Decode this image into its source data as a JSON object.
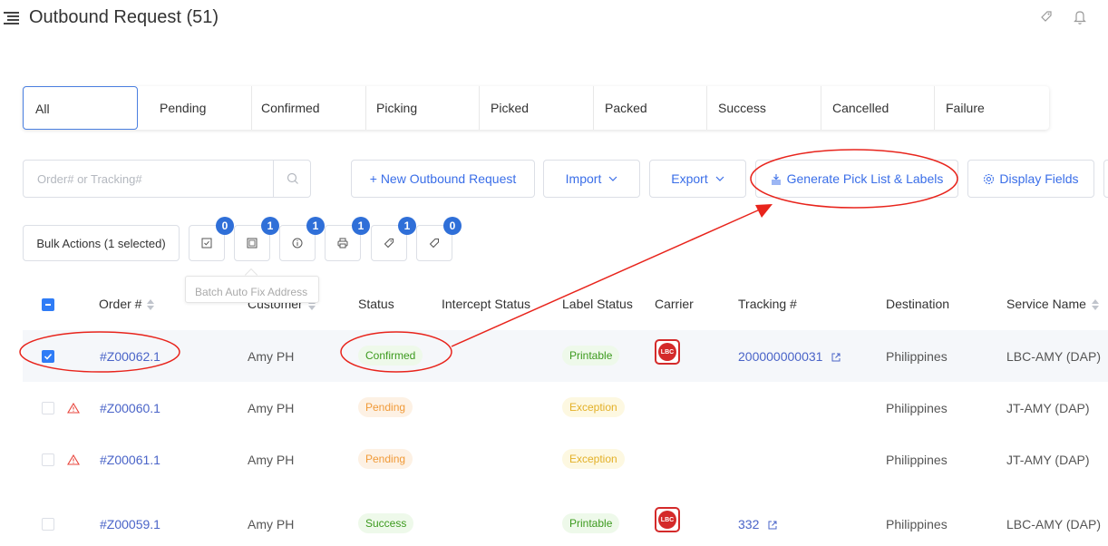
{
  "header": {
    "title": "Outbound Request (51)",
    "icons": [
      "menu-icon",
      "tag-icon",
      "bell-icon"
    ]
  },
  "tabs": [
    {
      "label": "All",
      "active": true
    },
    {
      "label": "Pending"
    },
    {
      "label": "Confirmed"
    },
    {
      "label": "Picking"
    },
    {
      "label": "Picked"
    },
    {
      "label": "Packed"
    },
    {
      "label": "Success"
    },
    {
      "label": "Cancelled"
    },
    {
      "label": "Failure"
    }
  ],
  "toolbar": {
    "search_placeholder": "Order# or Tracking#",
    "new_request": "+ New Outbound Request",
    "import": "Import",
    "export": "Export",
    "generate": "Generate Pick List & Labels",
    "display_fields": "Display Fields"
  },
  "bulk": {
    "label": "Bulk Actions (1 selected)",
    "badges": [
      "0",
      "1",
      "1",
      "1",
      "1",
      "0"
    ],
    "tooltip": "Batch Auto Fix Address"
  },
  "table": {
    "headers": {
      "order": "Order #",
      "customer": "Customer",
      "status": "Status",
      "intercept": "Intercept Status",
      "label_status": "Label Status",
      "carrier": "Carrier",
      "tracking": "Tracking #",
      "destination": "Destination",
      "service": "Service Name"
    },
    "rows": [
      {
        "order": "#Z00062.1",
        "customer": "Amy PH",
        "status": "Confirmed",
        "label_status": "Printable",
        "carrier": "LBC",
        "tracking": "200000000031",
        "destination": "Philippines",
        "service": "LBC-AMY (DAP)"
      },
      {
        "order": "#Z00060.1",
        "customer": "Amy PH",
        "status": "Pending",
        "label_status": "Exception",
        "carrier": "",
        "tracking": "",
        "destination": "Philippines",
        "service": "JT-AMY (DAP)"
      },
      {
        "order": "#Z00061.1",
        "customer": "Amy PH",
        "status": "Pending",
        "label_status": "Exception",
        "carrier": "",
        "tracking": "",
        "destination": "Philippines",
        "service": "JT-AMY (DAP)"
      },
      {
        "order": "#Z00059.1",
        "customer": "Amy PH",
        "status": "Success",
        "label_status": "Printable",
        "carrier": "LBC",
        "tracking": "332",
        "destination": "Philippines",
        "service": "LBC-AMY (DAP)"
      }
    ]
  },
  "colors": {
    "accent": "#3a6ee8",
    "link": "#4a64c8",
    "annotation": "#e8241c",
    "badge": "#2f6fd8"
  }
}
